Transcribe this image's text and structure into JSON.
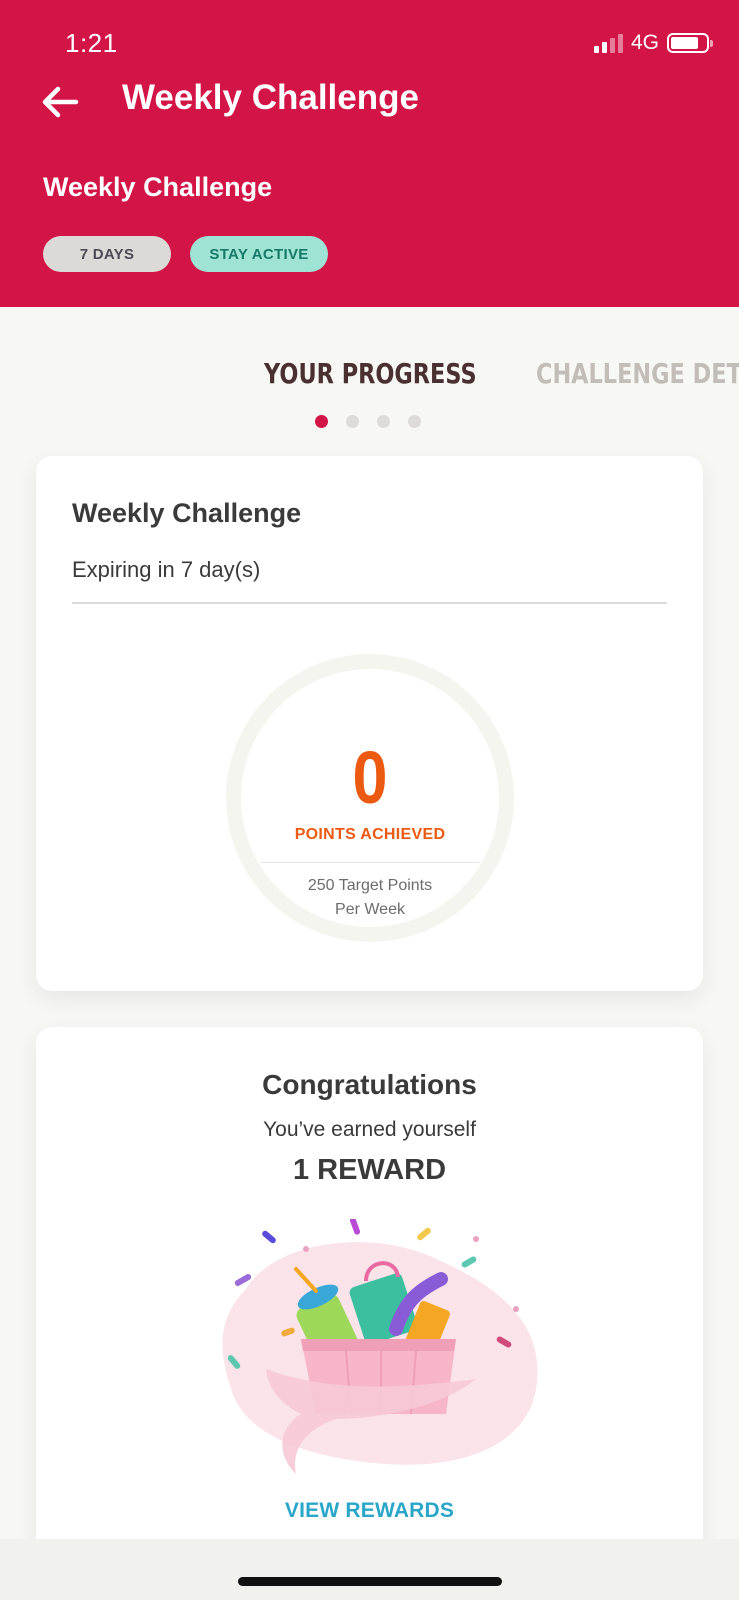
{
  "status_bar": {
    "time": "1:21",
    "network": "4G"
  },
  "header": {
    "title": "Weekly Challenge",
    "subtitle": "Weekly Challenge",
    "tags": [
      {
        "label": "7 DAYS",
        "color": "#dcdad6"
      },
      {
        "label": "STAY ACTIVE",
        "color": "#9fe3d5"
      }
    ],
    "background_color": "#d21446"
  },
  "tabs": [
    {
      "label": "YOUR PROGRESS",
      "active": true
    },
    {
      "label": "CHALLENGE DETAILS",
      "active": false
    }
  ],
  "pager": {
    "count": 4,
    "active_index": 0
  },
  "progress_card": {
    "title": "Weekly Challenge",
    "expiry": "Expiring in 7 day(s)",
    "points_value": "0",
    "points_label": "POINTS ACHIEVED",
    "target_line1": "250 Target Points",
    "target_line2": "Per Week",
    "accent_color": "#ec5a12"
  },
  "reward_card": {
    "heading": "Congratulations",
    "message": "You’ve earned yourself",
    "reward_count": "1 REWARD",
    "cta_label": "VIEW REWARDS",
    "cta_color": "#2aa6c9"
  }
}
